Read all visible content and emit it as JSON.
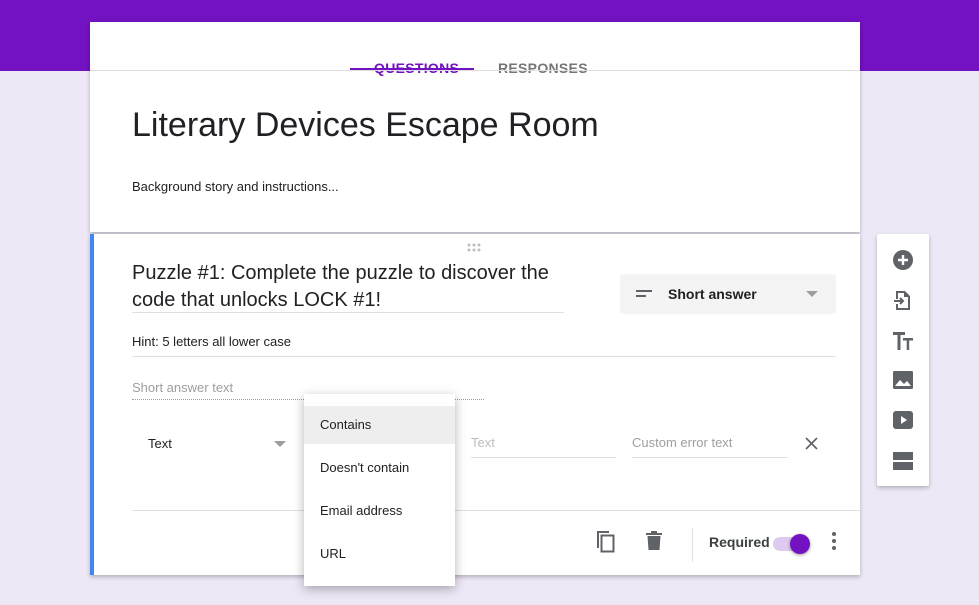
{
  "tabs": [
    {
      "label": "QUESTIONS",
      "active": true
    },
    {
      "label": "RESPONSES",
      "active": false
    }
  ],
  "form": {
    "title": "Literary Devices Escape Room",
    "description": "Background story and instructions..."
  },
  "question": {
    "title_line1": "Puzzle #1:  Complete the puzzle to discover the",
    "title_line2": "code that unlocks LOCK #1!",
    "description": "Hint:  5 letters all lower case",
    "type": "Short answer",
    "answer_placeholder": "Short answer text",
    "validation": {
      "category": "Text",
      "text_placeholder": "Text",
      "error_placeholder": "Custom error text"
    },
    "required_label": "Required",
    "required": true
  },
  "dropdown": {
    "items": [
      "Contains",
      "Doesn't contain",
      "Email address",
      "URL"
    ],
    "highlighted": "Contains"
  },
  "sidebar_tools": [
    "add-question-icon",
    "import-questions-icon",
    "add-title-icon",
    "add-image-icon",
    "add-video-icon",
    "add-section-icon"
  ],
  "colors": {
    "brand": "#7312c0",
    "accent_bar": "#4285f4",
    "background": "#eee8f6"
  }
}
